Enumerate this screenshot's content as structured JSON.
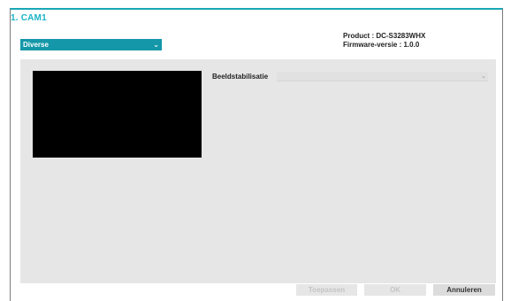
{
  "header": {
    "camera_title": "1. CAM1"
  },
  "menu_dropdown": {
    "selected": "Diverse",
    "icon": "chevron-down-icon"
  },
  "device_info": {
    "product": "Product : DC-S3283WHX",
    "firmware": "Firmware-versie : 1.0.0"
  },
  "settings": {
    "image_stabilization_label": "Beeldstabilisatie",
    "image_stabilization_value": ""
  },
  "buttons": {
    "apply": "Toepassen",
    "ok": "OK",
    "cancel": "Annuleren"
  },
  "colors": {
    "accent": "#19b4c6",
    "dropdown_bg": "#1497a8",
    "panel_bg": "#e6e6e6"
  }
}
